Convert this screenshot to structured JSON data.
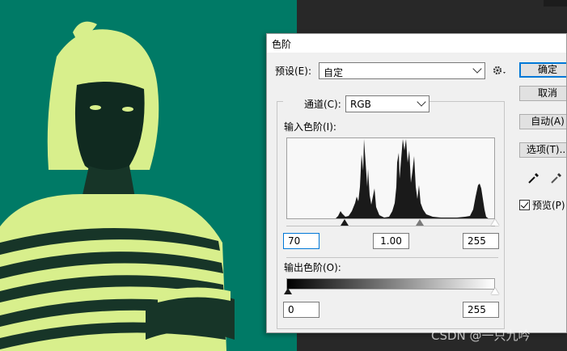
{
  "colors": {
    "canvas_bg": "#007a66",
    "subject": "#d8ef8c",
    "workspace": "#282828",
    "accent": "#0078d7"
  },
  "dialog": {
    "title": "色阶",
    "preset_label": "预设(E):",
    "preset_value": "自定",
    "gear_icon": "gear-icon",
    "channel_label": "通道(C):",
    "channel_value": "RGB",
    "input_levels_label": "输入色阶(I):",
    "input_black": "70",
    "input_gamma": "1.00",
    "input_white": "255",
    "output_levels_label": "输出色阶(O):",
    "output_black": "0",
    "output_white": "255",
    "buttons": {
      "ok": "确定",
      "cancel": "取消",
      "auto": "自动(A)",
      "options": "选项(T)..."
    },
    "preview_label": "预览(P)",
    "preview_checked": true
  },
  "watermark": "CSDN @一只九吟"
}
